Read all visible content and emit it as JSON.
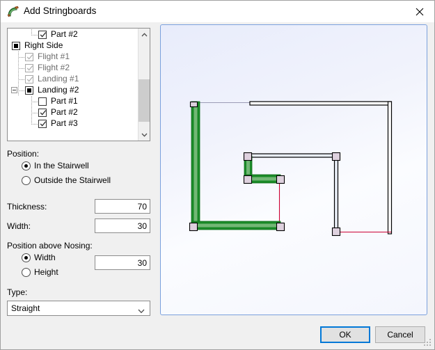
{
  "window": {
    "title": "Add Stringboards",
    "icon": "stringboard-icon",
    "close_label": "close-icon"
  },
  "tree": {
    "name": "stringboard-tree",
    "scrollbar": {
      "up_label": "scroll-up-icon",
      "down_label": "scroll-down-icon"
    },
    "items": [
      {
        "label": "Part #2",
        "depth": 2,
        "state": "checked",
        "enabled": true,
        "expander": "none"
      },
      {
        "label": "Right Side",
        "depth": 0,
        "state": "partial",
        "enabled": true,
        "expander": "none"
      },
      {
        "label": "Flight #1",
        "depth": 1,
        "state": "checked",
        "enabled": false,
        "expander": "none"
      },
      {
        "label": "Flight #2",
        "depth": 1,
        "state": "checked",
        "enabled": false,
        "expander": "none"
      },
      {
        "label": "Landing #1",
        "depth": 1,
        "state": "checked",
        "enabled": false,
        "expander": "none"
      },
      {
        "label": "Landing #2",
        "depth": 1,
        "state": "partial",
        "enabled": true,
        "expander": "collapse"
      },
      {
        "label": "Part #1",
        "depth": 2,
        "state": "unchecked",
        "enabled": true,
        "expander": "none"
      },
      {
        "label": "Part #2",
        "depth": 2,
        "state": "checked",
        "enabled": true,
        "expander": "none"
      },
      {
        "label": "Part #3",
        "depth": 2,
        "state": "checked",
        "enabled": true,
        "expander": "none"
      }
    ]
  },
  "position_group": {
    "label": "Position:",
    "options": [
      {
        "label": "In the Stairwell",
        "selected": true
      },
      {
        "label": "Outside the Stairwell",
        "selected": false
      }
    ]
  },
  "thickness": {
    "label": "Thickness:",
    "value": "70"
  },
  "width": {
    "label": "Width:",
    "value": "30"
  },
  "nosing_group": {
    "label": "Position above Nosing:",
    "options": [
      {
        "label": "Width",
        "selected": true
      },
      {
        "label": "Height",
        "selected": false
      }
    ],
    "value": "30"
  },
  "type_group": {
    "label": "Type:",
    "selected": "Straight",
    "options": [
      "Straight"
    ]
  },
  "footer": {
    "ok_label": "OK",
    "cancel_label": "Cancel"
  },
  "preview": {
    "name": "stairwell-preview",
    "colors": {
      "stringboard": "#1a8a28",
      "stringboard_highlight": "#72b775",
      "wall": "#000000",
      "wall_fill": "#ffffff",
      "nosing_line": "#cc0033",
      "node": "#ded1de",
      "panel_border": "#7aa0dd"
    }
  }
}
